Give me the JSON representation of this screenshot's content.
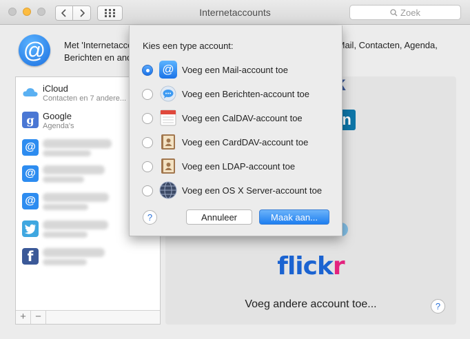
{
  "window": {
    "title": "Internetaccounts",
    "search_placeholder": "Zoek"
  },
  "header": {
    "text": "Met 'Internetaccounts' kunt u uw accounts instellen voor gebruik met Mail, Contacten, Agenda, Berichten en andere apps."
  },
  "sidebar": {
    "items": [
      {
        "name": "iCloud",
        "sub": "Contacten en 7 andere...",
        "icon": "icloud-icon"
      },
      {
        "name": "Google",
        "sub": "Agenda's",
        "icon": "google-icon"
      }
    ],
    "footer": {
      "add": "+",
      "remove": "−"
    }
  },
  "right_panel": {
    "flickr_a": "flick",
    "flickr_b": "r",
    "add_other": "Voeg andere account toe...",
    "help": "?",
    "peek_facebook": "k",
    "peek_linkedin": "in"
  },
  "sheet": {
    "title": "Kies een type account:",
    "options": [
      {
        "label": "Voeg een Mail-account toe",
        "icon": "mail-at-icon",
        "selected": true
      },
      {
        "label": "Voeg een Berichten-account toe",
        "icon": "messages-icon",
        "selected": false
      },
      {
        "label": "Voeg een CalDAV-account toe",
        "icon": "calendar-icon",
        "selected": false
      },
      {
        "label": "Voeg een CardDAV-account toe",
        "icon": "contacts-icon",
        "selected": false
      },
      {
        "label": "Voeg een LDAP-account toe",
        "icon": "contacts-icon",
        "selected": false
      },
      {
        "label": "Voeg een OS X Server-account toe",
        "icon": "osx-server-icon",
        "selected": false
      }
    ],
    "help": "?",
    "cancel": "Annuleer",
    "create": "Maak aan..."
  },
  "colors": {
    "accent": "#1b73e8",
    "flickr_blue": "#1b63d1",
    "flickr_pink": "#e3237e"
  }
}
